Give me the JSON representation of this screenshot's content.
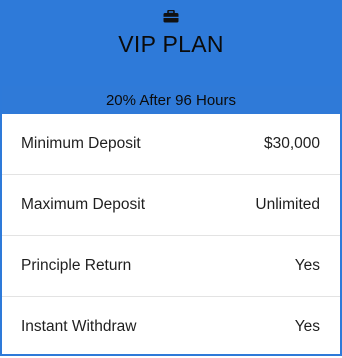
{
  "plan": {
    "icon": "briefcase-icon",
    "title": "VIP PLAN",
    "subtitle": "20% After 96 Hours",
    "accent_color": "#2e7ad9"
  },
  "rows": [
    {
      "label": "Minimum Deposit",
      "value": "$30,000"
    },
    {
      "label": "Maximum Deposit",
      "value": "Unlimited"
    },
    {
      "label": "Principle Return",
      "value": "Yes"
    },
    {
      "label": "Instant Withdraw",
      "value": "Yes"
    }
  ]
}
